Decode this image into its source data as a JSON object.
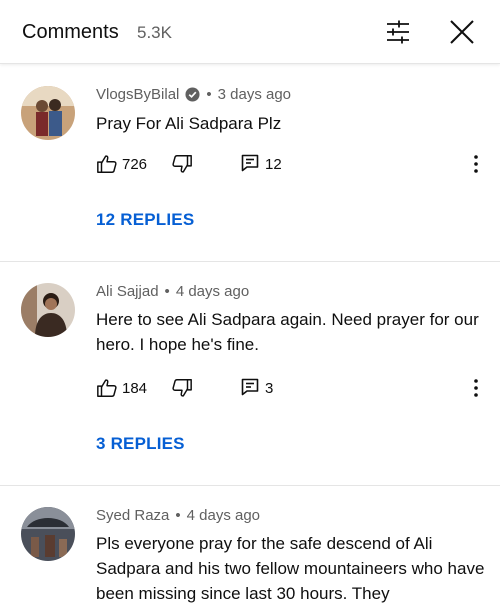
{
  "header": {
    "title": "Comments",
    "count": "5.3K"
  },
  "comments": [
    {
      "author": "VlogsByBilal",
      "verified": true,
      "time": "3 days ago",
      "text": "Pray For Ali Sadpara Plz",
      "likes": "726",
      "replies_count": "12",
      "replies_label": "12 REPLIES"
    },
    {
      "author": "Ali Sajjad",
      "verified": false,
      "time": "4 days ago",
      "text": "Here to see Ali Sadpara again. Need prayer for our hero. I hope he's fine.",
      "likes": "184",
      "replies_count": "3",
      "replies_label": "3 REPLIES"
    },
    {
      "author": "Syed Raza",
      "verified": false,
      "time": "4 days ago",
      "text": "Pls everyone pray for the safe descend of Ali Sadpara and his two fellow mountaineers who have been missing since last 30 hours. They"
    }
  ],
  "separator": "•",
  "colors": {
    "link_blue": "#065fd4",
    "meta_gray": "#606060",
    "text": "#0f0f0f",
    "divider": "#e5e5e5",
    "notification_red": "#ff0000"
  },
  "icons": {
    "filter": "filter-sliders-icon",
    "close": "close-icon",
    "like": "thumbs-up-icon",
    "dislike": "thumbs-down-icon",
    "reply": "reply-comment-icon",
    "more": "more-vertical-icon",
    "verified": "verified-check-icon"
  }
}
